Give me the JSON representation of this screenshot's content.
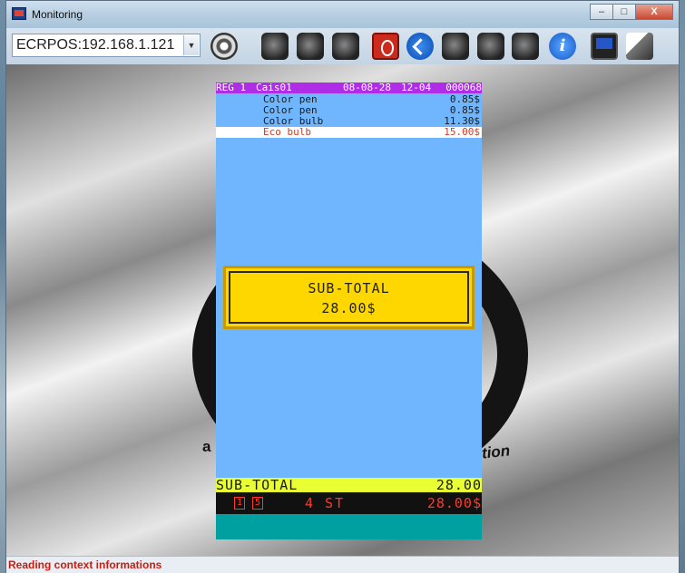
{
  "window": {
    "title": "Monitoring",
    "controls": {
      "minimize": "–",
      "maximize": "□",
      "close": "X"
    }
  },
  "toolbar": {
    "device_select": "ECRPOS:192.168.1.121",
    "icons": [
      "disc-icon",
      "gear-icon",
      "hand-icon",
      "grid-icon",
      "power-icon",
      "refresh-icon",
      "user-icon",
      "user2-icon",
      "camera-icon",
      "info-icon",
      "monitor-icon",
      "eraser-icon"
    ],
    "info_glyph": "i"
  },
  "background_logo": {
    "left_text": "a",
    "right_text": "tion"
  },
  "receipt": {
    "header": {
      "register": "REG 1",
      "cashier": "Cais01",
      "date": "08-08-28",
      "time": "12-04",
      "number": "000068"
    },
    "items": [
      {
        "name": "Color pen",
        "price": "0.85$",
        "selected": false
      },
      {
        "name": "Color pen",
        "price": "0.85$",
        "selected": false
      },
      {
        "name": "Color bulb",
        "price": "11.30$",
        "selected": false
      },
      {
        "name": "Eco bulb",
        "price": "15.00$",
        "selected": true
      }
    ],
    "subtotal_box": {
      "label": "SUB-TOTAL",
      "value": "28.00$"
    },
    "subtotal_bar": {
      "label": "SUB-TOTAL",
      "value": "28.00"
    },
    "status": {
      "icon1": "1",
      "icon2": "5",
      "count": "4 ST",
      "total": "28.00$"
    },
    "colors": {
      "screen": "#70b6ff",
      "header": "#b02de8",
      "subtotal": "#ffd700",
      "bar": "#e9ff33",
      "teal": "#00a0a0"
    }
  },
  "statusline": {
    "text": "Reading context informations"
  }
}
